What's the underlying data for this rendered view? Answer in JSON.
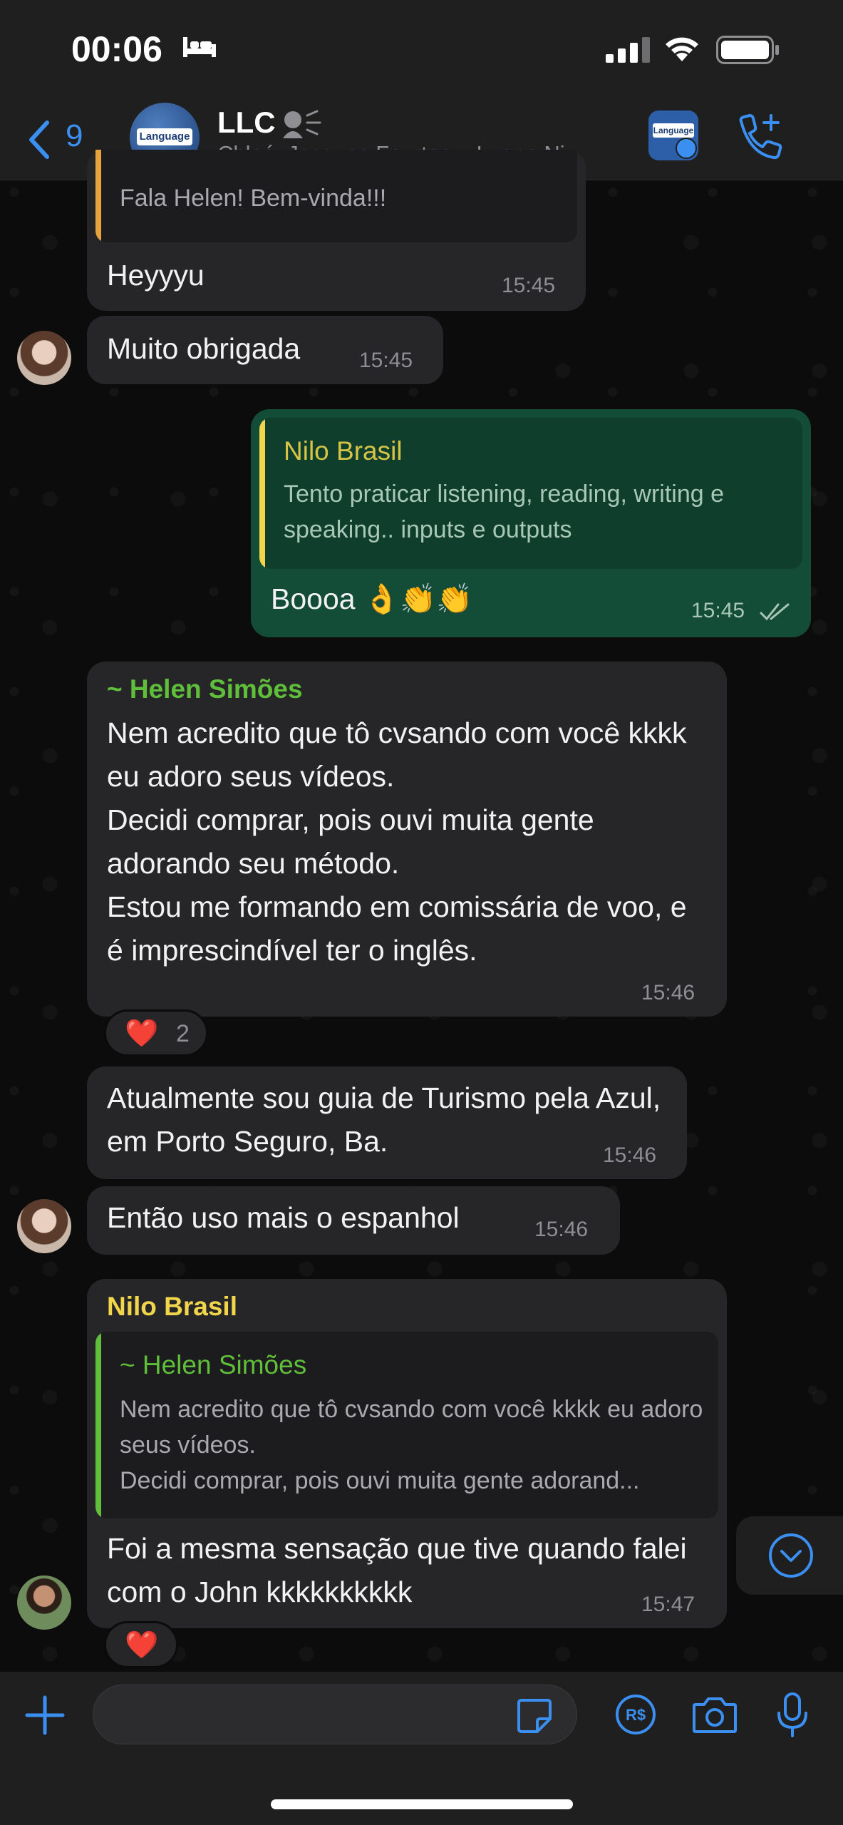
{
  "status_bar": {
    "time": "00:06"
  },
  "header": {
    "back_count": "9",
    "group_name": "LLC",
    "members": "Chloé, Jacques Fourteau, Luana Ni...",
    "avatar_badge": "Language"
  },
  "messages": [
    {
      "quote_text": "Fala Helen! Bem-vinda!!!",
      "text": "Heyyyu",
      "time": "15:45"
    },
    {
      "text": "Muito obrigada",
      "time": "15:45"
    },
    {
      "quote_sender": "Nilo Brasil",
      "quote_text": "Tento praticar listening, reading, writing e speaking.. inputs e outputs",
      "text": "Boooa 👌👏👏",
      "time": "15:45"
    },
    {
      "sender": "~ Helen Simões",
      "text": "Nem acredito que tô cvsando com você kkkk eu adoro seus vídeos.\nDecidi comprar, pois ouvi muita gente adorando seu método.\nEstou me formando em comissária de voo, e é imprescindível ter o inglês.",
      "time": "15:46",
      "reaction": {
        "emoji": "❤️",
        "count": "2"
      }
    },
    {
      "text": "Atualmente sou guia de Turismo pela Azul, em Porto Seguro, Ba.",
      "time": "15:46"
    },
    {
      "text": "Então uso mais o espanhol",
      "time": "15:46"
    },
    {
      "sender": "Nilo Brasil",
      "quote_sender": "~ Helen Simões",
      "quote_text": "Nem acredito que tô cvsando com você kkkk eu adoro seus vídeos.\nDecidi comprar, pois ouvi muita gente adorand...",
      "text": "Foi a mesma sensação que tive quando falei com o John kkkkkkkkkk",
      "time": "15:47",
      "reaction": {
        "emoji": "❤️"
      }
    }
  ],
  "colors": {
    "accent": "#3b8ff0",
    "outgoing_bubble": "#144d37",
    "incoming_bubble": "#262628",
    "helen_name": "#5fbf3a",
    "nilo_name": "#f1d54a",
    "quote_orange": "#e8a33d"
  }
}
